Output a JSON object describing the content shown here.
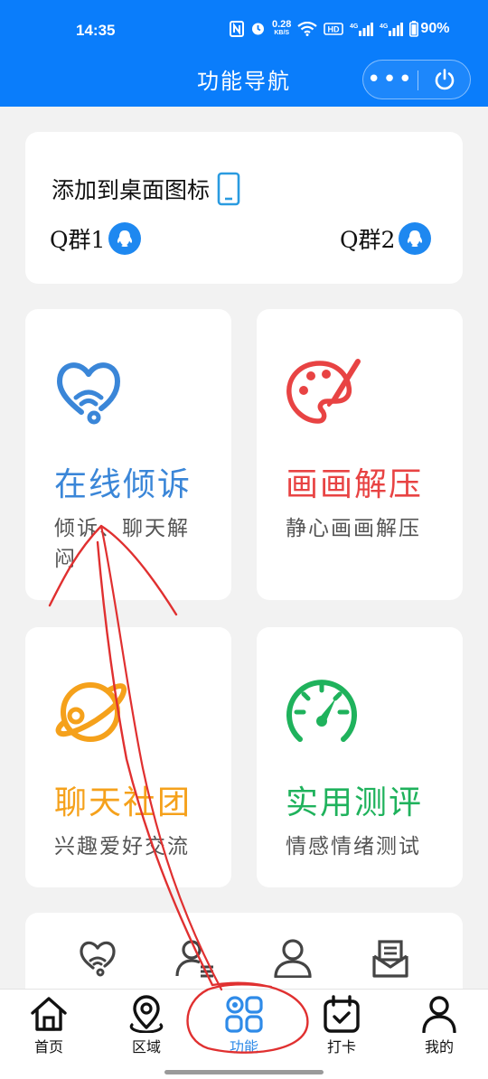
{
  "status": {
    "time": "14:35",
    "net_speed_value": "0.28",
    "net_speed_unit": "KB/S",
    "battery": "90%"
  },
  "header": {
    "title": "功能导航",
    "more_label": "•••"
  },
  "top_card": {
    "add_desktop": "添加到桌面图标",
    "q_group_1": "Q群1",
    "q_group_2": "Q群2"
  },
  "features": [
    {
      "title": "在线倾诉",
      "subtitle": "倾诉、聊天解闷",
      "color": "#3a86d8",
      "icon": "heart-wifi-icon"
    },
    {
      "title": "画画解压",
      "subtitle": "静心画画解压",
      "color": "#e84343",
      "icon": "palette-icon"
    },
    {
      "title": "聊天社团",
      "subtitle": "兴趣爱好交流",
      "color": "#f5a11b",
      "icon": "planet-icon"
    },
    {
      "title": "实用测评",
      "subtitle": "情感情绪测试",
      "color": "#1fb25c",
      "icon": "speedometer-icon"
    }
  ],
  "tabbar": {
    "items": [
      {
        "label": "首页",
        "icon": "home-icon"
      },
      {
        "label": "区域",
        "icon": "location-icon"
      },
      {
        "label": "功能",
        "icon": "apps-icon",
        "active": true
      },
      {
        "label": "打卡",
        "icon": "calendar-check-icon"
      },
      {
        "label": "我的",
        "icon": "user-icon"
      }
    ],
    "active_color": "#2f8be8"
  },
  "colors": {
    "brand": "#0a7dfb",
    "annotation": "#e03030"
  }
}
